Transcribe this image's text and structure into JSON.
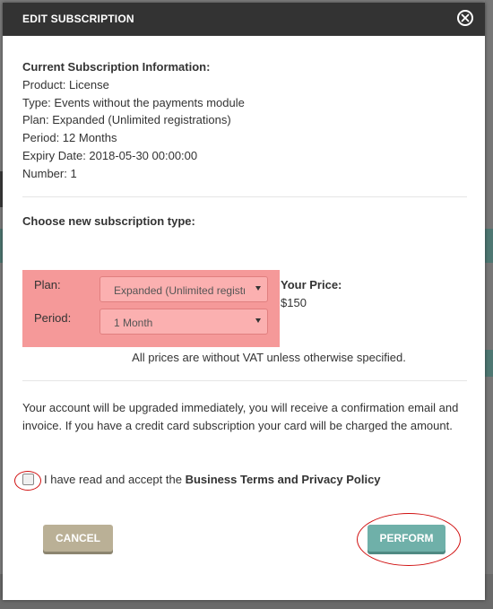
{
  "modal": {
    "title": "EDIT SUBSCRIPTION",
    "close_icon": "close-circle-icon"
  },
  "current": {
    "heading": "Current Subscription Information:",
    "product": "Product: License",
    "type": "Type: Events without the payments module",
    "plan": "Plan: Expanded (Unlimited registrations)",
    "period": "Period: 12 Months",
    "expiry": "Expiry Date: 2018-05-30 00:00:00",
    "number": "Number: 1"
  },
  "choose": {
    "title": "Choose new subscription type:",
    "plan_label": "Plan:",
    "plan_value": "Expanded (Unlimited registrations)",
    "period_label": "Period:",
    "period_value": "1 Month",
    "price_label": "Your Price:",
    "price_value": "$150",
    "vat_note": "All prices are without VAT unless otherwise specified."
  },
  "notice": {
    "upgrade_text": "Your account will be upgraded immediately, you will receive a confirmation email and invoice. If you have a credit card subscription your card will be charged the amount."
  },
  "terms": {
    "prefix": "I have read and accept the ",
    "link": "Business Terms and Privacy Policy",
    "checked": false
  },
  "buttons": {
    "cancel": "CANCEL",
    "perform": "PERFORM"
  },
  "colors": {
    "header_bg": "#333333",
    "highlight": "#f59999",
    "cancel_btn": "#bab096",
    "perform_btn": "#6fb0a9",
    "annotation_ring": "#d01010"
  }
}
